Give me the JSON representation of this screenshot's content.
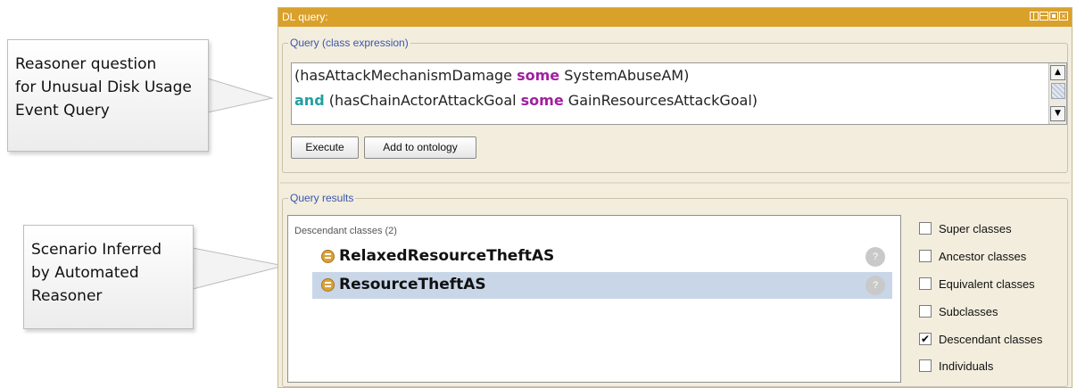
{
  "callouts": {
    "top": [
      "Reasoner question",
      "for Unusual Disk Usage",
      "Event Query"
    ],
    "bottom": [
      "Scenario Inferred",
      "by Automated",
      "Reasoner"
    ]
  },
  "window": {
    "title": "DL query:",
    "controls": [
      "split-view-icon",
      "horizontal-split-icon",
      "maximize-icon",
      "close-icon"
    ]
  },
  "query": {
    "legend": "Query (class expression)",
    "line1": {
      "a": "(hasAttackMechanismDamage ",
      "kw": "some",
      "b": " SystemAbuseAM)"
    },
    "line2": {
      "kw1": "and",
      "a": " (hasChainActorAttackGoal ",
      "kw2": "some",
      "b": " GainResourcesAttackGoal)"
    },
    "execute_label": "Execute",
    "add_label": "Add to ontology"
  },
  "results": {
    "legend": "Query results",
    "header": "Descendant classes (2)",
    "items": [
      {
        "label": "RelaxedResourceTheftAS",
        "selected": false
      },
      {
        "label": "ResourceTheftAS",
        "selected": true
      }
    ],
    "help_glyph": "?",
    "options": [
      {
        "label": "Super classes",
        "checked": false
      },
      {
        "label": "Ancestor classes",
        "checked": false
      },
      {
        "label": "Equivalent classes",
        "checked": false
      },
      {
        "label": "Subclasses",
        "checked": false
      },
      {
        "label": "Descendant classes",
        "checked": true
      },
      {
        "label": "Individuals",
        "checked": false
      }
    ]
  },
  "colors": {
    "titlebar": "#d9a02a",
    "keyword_some": "#a020a0",
    "keyword_and": "#20a0a0",
    "legend_text": "#3a56b0",
    "selection": "#c8d6e8"
  }
}
